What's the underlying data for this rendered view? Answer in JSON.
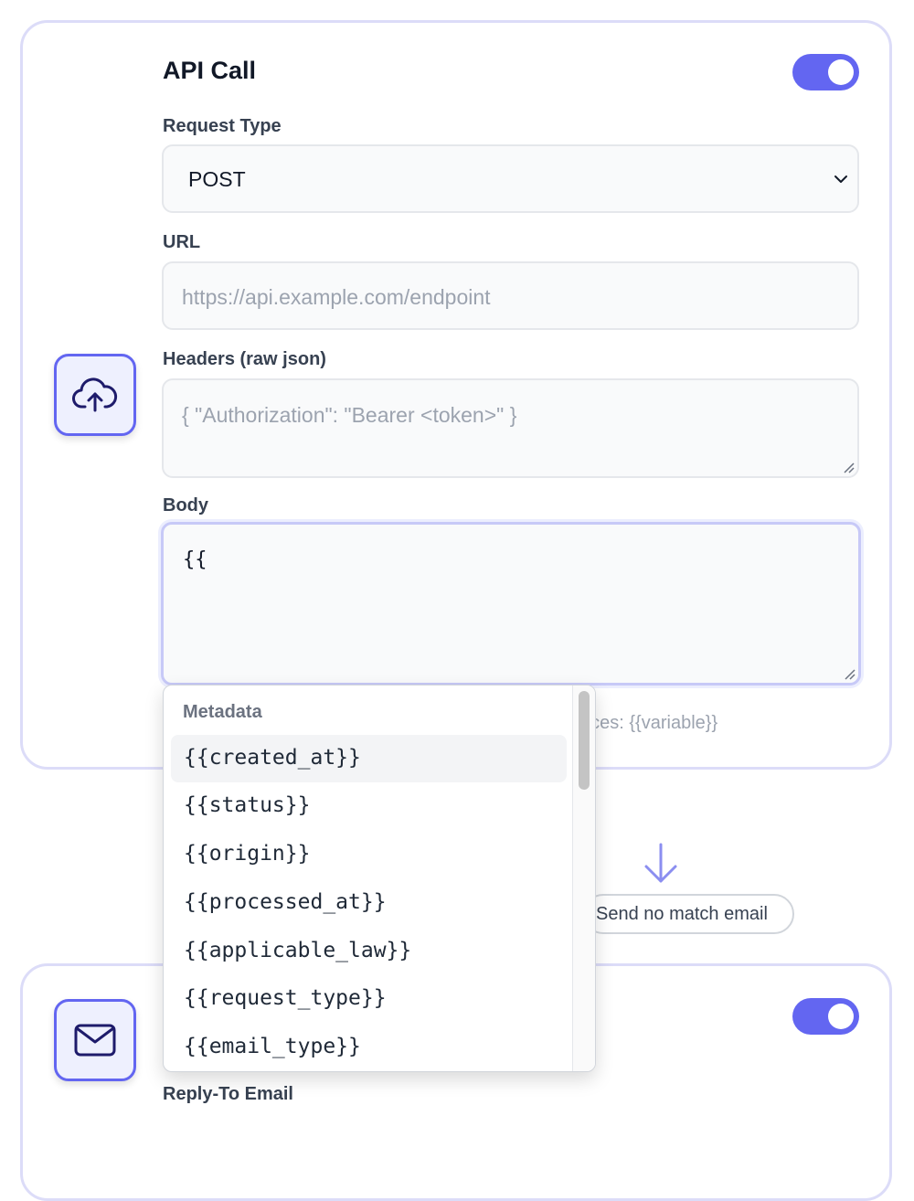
{
  "api_card": {
    "title": "API Call",
    "toggle_on": true,
    "request_type": {
      "label": "Request Type",
      "value": "POST"
    },
    "url": {
      "label": "URL",
      "placeholder": "https://api.example.com/endpoint"
    },
    "headers": {
      "label": "Headers (raw json)",
      "placeholder": "{ \"Authorization\": \"Bearer <token>\" }"
    },
    "body": {
      "label": "Body",
      "value": "{{"
    },
    "hint_visible": "aces: {{variable}}",
    "icon": "cloud-upload-icon"
  },
  "connector": {
    "pill_label": "Send no match email",
    "icon": "arrow-down-icon"
  },
  "email_card": {
    "toggle_on": true,
    "reply_to_label": "Reply-To Email",
    "icon": "mail-icon"
  },
  "dropdown": {
    "group_label": "Metadata",
    "options": [
      "{{created_at}}",
      "{{status}}",
      "{{origin}}",
      "{{processed_at}}",
      "{{applicable_law}}",
      "{{request_type}}",
      "{{email_type}}"
    ]
  },
  "colors": {
    "accent": "#6366f1",
    "card_border": "#dcdcf8"
  }
}
